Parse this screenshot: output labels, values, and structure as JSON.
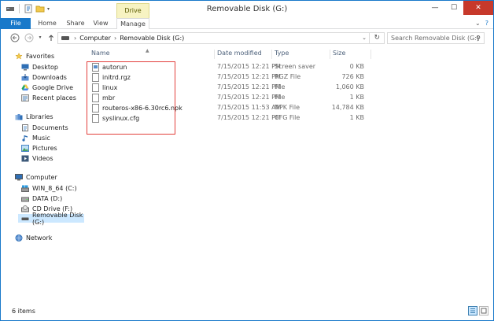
{
  "window": {
    "title": "Removable Disk (G:)"
  },
  "context_tab": "Drive Tools",
  "ribbon": {
    "tabs": [
      "File",
      "Home",
      "Share",
      "View",
      "Manage"
    ]
  },
  "address": {
    "path": [
      "Computer",
      "Removable Disk (G:)"
    ],
    "search_placeholder": "Search Removable Disk (G:)"
  },
  "nav": {
    "favorites": {
      "label": "Favorites",
      "items": [
        "Desktop",
        "Downloads",
        "Google Drive",
        "Recent places"
      ]
    },
    "libraries": {
      "label": "Libraries",
      "items": [
        "Documents",
        "Music",
        "Pictures",
        "Videos"
      ]
    },
    "computer": {
      "label": "Computer",
      "items": [
        "WIN_8_64 (C:)",
        "DATA (D:)",
        "CD Drive (F:)",
        "Removable Disk (G:)"
      ]
    },
    "network": {
      "label": "Network"
    }
  },
  "columns": {
    "name": "Name",
    "date": "Date modified",
    "type": "Type",
    "size": "Size"
  },
  "files": [
    {
      "name": "autorun",
      "date": "7/15/2015 12:21 PM",
      "type": "Screen saver",
      "size": "0 KB"
    },
    {
      "name": "initrd.rgz",
      "date": "7/15/2015 12:21 PM",
      "type": "RGZ File",
      "size": "726 KB"
    },
    {
      "name": "linux",
      "date": "7/15/2015 12:21 PM",
      "type": "File",
      "size": "1,060 KB"
    },
    {
      "name": "mbr",
      "date": "7/15/2015 12:21 PM",
      "type": "File",
      "size": "1 KB"
    },
    {
      "name": "routeros-x86-6.30rc6.npk",
      "date": "7/15/2015 11:53 AM",
      "type": "NPK File",
      "size": "14,784 KB"
    },
    {
      "name": "syslinux.cfg",
      "date": "7/15/2015 12:21 PM",
      "type": "CFG File",
      "size": "1 KB"
    }
  ],
  "status": {
    "item_count": "6 items"
  },
  "colors": {
    "accent": "#1979ca",
    "close": "#c7392b",
    "selection": "#cce8ff",
    "highlight_box": "#e2403c"
  }
}
